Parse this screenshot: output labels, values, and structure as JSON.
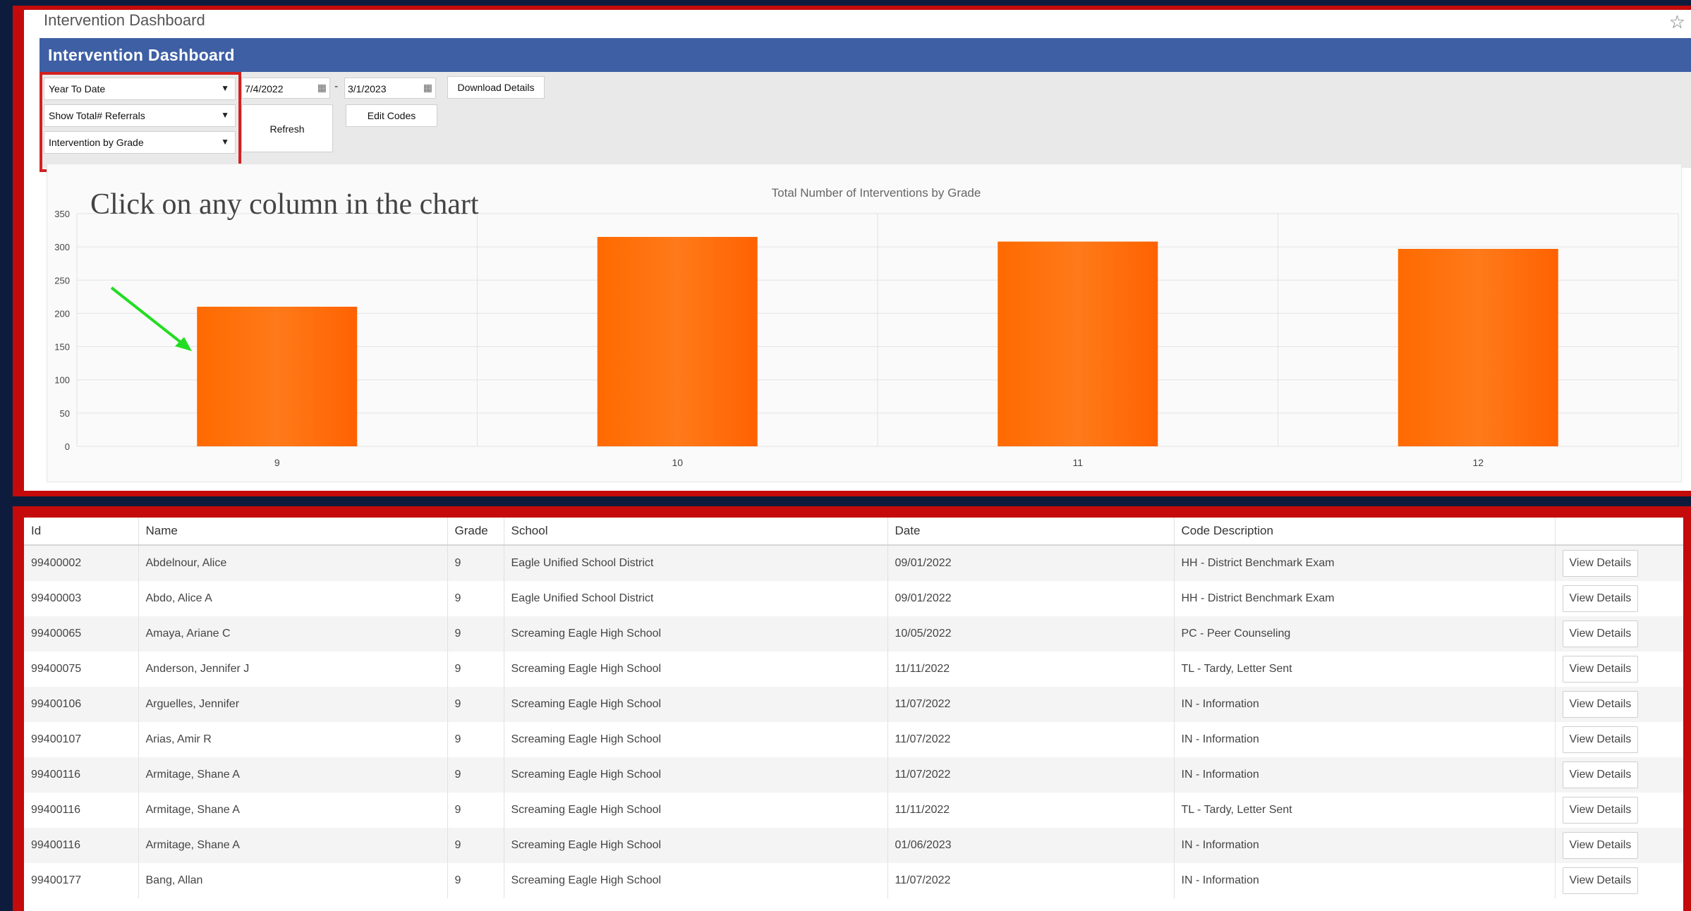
{
  "page": {
    "title": "Intervention Dashboard"
  },
  "header": {
    "title": "Intervention Dashboard"
  },
  "filters": {
    "date_range": "Year To Date",
    "show_total": "Show Total# Referrals",
    "group_by": "Intervention by Grade",
    "start_date": "7/4/2022",
    "end_date": "3/1/2023",
    "separator": "-"
  },
  "buttons": {
    "refresh": "Refresh",
    "download": "Download Details",
    "edit_codes": "Edit Codes"
  },
  "annotation": "Click on any column in the chart",
  "icons": {
    "star": "star-icon",
    "calendar": "calendar-icon",
    "dropdown": "chevron-down-icon",
    "arrow": "arrow-icon"
  },
  "colors": {
    "header_bg": "#3e5fa4",
    "bar": "#ff7a1a",
    "frame": "#c40a0a",
    "highlight": "#d32020",
    "arrow": "#22dd22"
  },
  "chart_data": {
    "type": "bar",
    "title": "Total Number of Interventions by Grade",
    "categories": [
      "9",
      "10",
      "11",
      "12"
    ],
    "values": [
      210,
      315,
      308,
      297
    ],
    "ylim": [
      0,
      350
    ],
    "yticks": [
      0,
      50,
      100,
      150,
      200,
      250,
      300,
      350
    ],
    "xlabel": "",
    "ylabel": "",
    "grid": true,
    "legend": "none"
  },
  "table": {
    "columns": [
      "Id",
      "Name",
      "Grade",
      "School",
      "Date",
      "Code Description",
      ""
    ],
    "rows": [
      [
        "99400002",
        "Abdelnour, Alice",
        "9",
        "Eagle Unified School District",
        "09/01/2022",
        "HH - District Benchmark Exam",
        "View Details"
      ],
      [
        "99400003",
        "Abdo, Alice A",
        "9",
        "Eagle Unified School District",
        "09/01/2022",
        "HH - District Benchmark Exam",
        "View Details"
      ],
      [
        "99400065",
        "Amaya, Ariane C",
        "9",
        "Screaming Eagle High School",
        "10/05/2022",
        "PC - Peer Counseling",
        "View Details"
      ],
      [
        "99400075",
        "Anderson, Jennifer J",
        "9",
        "Screaming Eagle High School",
        "11/11/2022",
        "TL - Tardy, Letter Sent",
        "View Details"
      ],
      [
        "99400106",
        "Arguelles, Jennifer",
        "9",
        "Screaming Eagle High School",
        "11/07/2022",
        "IN - Information",
        "View Details"
      ],
      [
        "99400107",
        "Arias, Amir R",
        "9",
        "Screaming Eagle High School",
        "11/07/2022",
        "IN - Information",
        "View Details"
      ],
      [
        "99400116",
        "Armitage, Shane A",
        "9",
        "Screaming Eagle High School",
        "11/07/2022",
        "IN - Information",
        "View Details"
      ],
      [
        "99400116",
        "Armitage, Shane A",
        "9",
        "Screaming Eagle High School",
        "11/11/2022",
        "TL - Tardy, Letter Sent",
        "View Details"
      ],
      [
        "99400116",
        "Armitage, Shane A",
        "9",
        "Screaming Eagle High School",
        "01/06/2023",
        "IN - Information",
        "View Details"
      ],
      [
        "99400177",
        "Bang, Allan",
        "9",
        "Screaming Eagle High School",
        "11/07/2022",
        "IN - Information",
        "View Details"
      ]
    ]
  }
}
